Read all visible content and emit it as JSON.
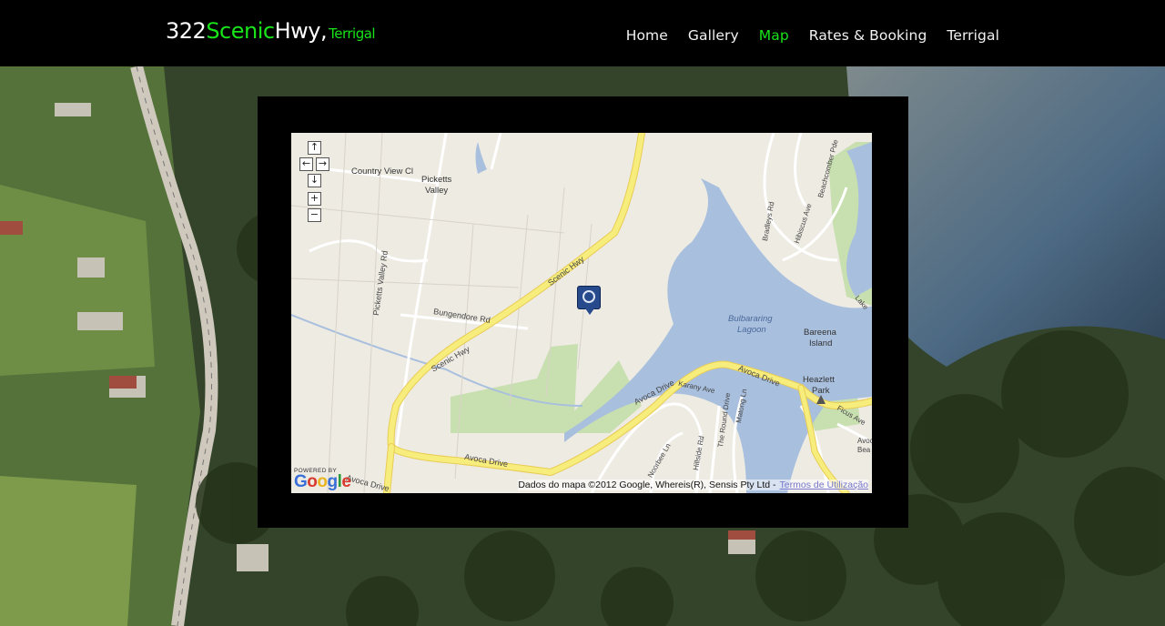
{
  "logo": {
    "part1": "322",
    "part2": "Scenic",
    "part3": "Hwy,",
    "part4": "Terrigal"
  },
  "nav": [
    {
      "label": "Home",
      "active": false
    },
    {
      "label": "Gallery",
      "active": false
    },
    {
      "label": "Map",
      "active": true
    },
    {
      "label": "Rates & Booking",
      "active": false
    },
    {
      "label": "Terrigal",
      "active": false
    }
  ],
  "map": {
    "controls": {
      "up": "↑",
      "left": "←",
      "right": "→",
      "down": "↓",
      "zoom_in": "+",
      "zoom_out": "−"
    },
    "labels": {
      "country_view": "Country View Cl",
      "picketts_valley": "Picketts",
      "picketts_valley2": "Valley",
      "picketts_valley_rd": "Picketts Valley Rd",
      "bungendore": "Bungendore Rd",
      "scenic_hwy_1": "Scenic Hwy",
      "scenic_hwy_2": "Scenic Hwy",
      "bulbararing": "Bulbararing",
      "lagoon": "Lagoon",
      "bareena": "Bareena",
      "island": "Island",
      "heazlett": "Heazlett",
      "park": "Park",
      "avoca_drive_1": "Avoca Drive",
      "avoca_drive_2": "Avoca Drive",
      "avoca_drive_3": "Avoca Drive",
      "avoca_drive_4": "Avoca Drive",
      "karany": "Karany Ave",
      "matong": "Matong Ln",
      "round_drive": "The Round Drive",
      "hillside": "Hillside Rd",
      "noorbee": "Noorbee Ln",
      "bradleys": "Bradleys Rd",
      "hibiscus": "Hibiscus Ave",
      "beachcomber": "Beachcomber Pde",
      "lake": "Lake",
      "ficus": "Ficus Ave",
      "avoca_beach": "Avoca",
      "avoca_beach2": "Bea"
    },
    "powered_by": "POWERED BY",
    "google": "Google",
    "attribution": "Dados do mapa ©2012 Google, Whereis(R), Sensis Pty Ltd -",
    "terms": "Termos de Utilização"
  },
  "colors": {
    "accent": "#19e319",
    "header_bg": "#000000",
    "water": "#a8bfde",
    "road": "#f7ed7c",
    "park": "#c8dfb0"
  }
}
